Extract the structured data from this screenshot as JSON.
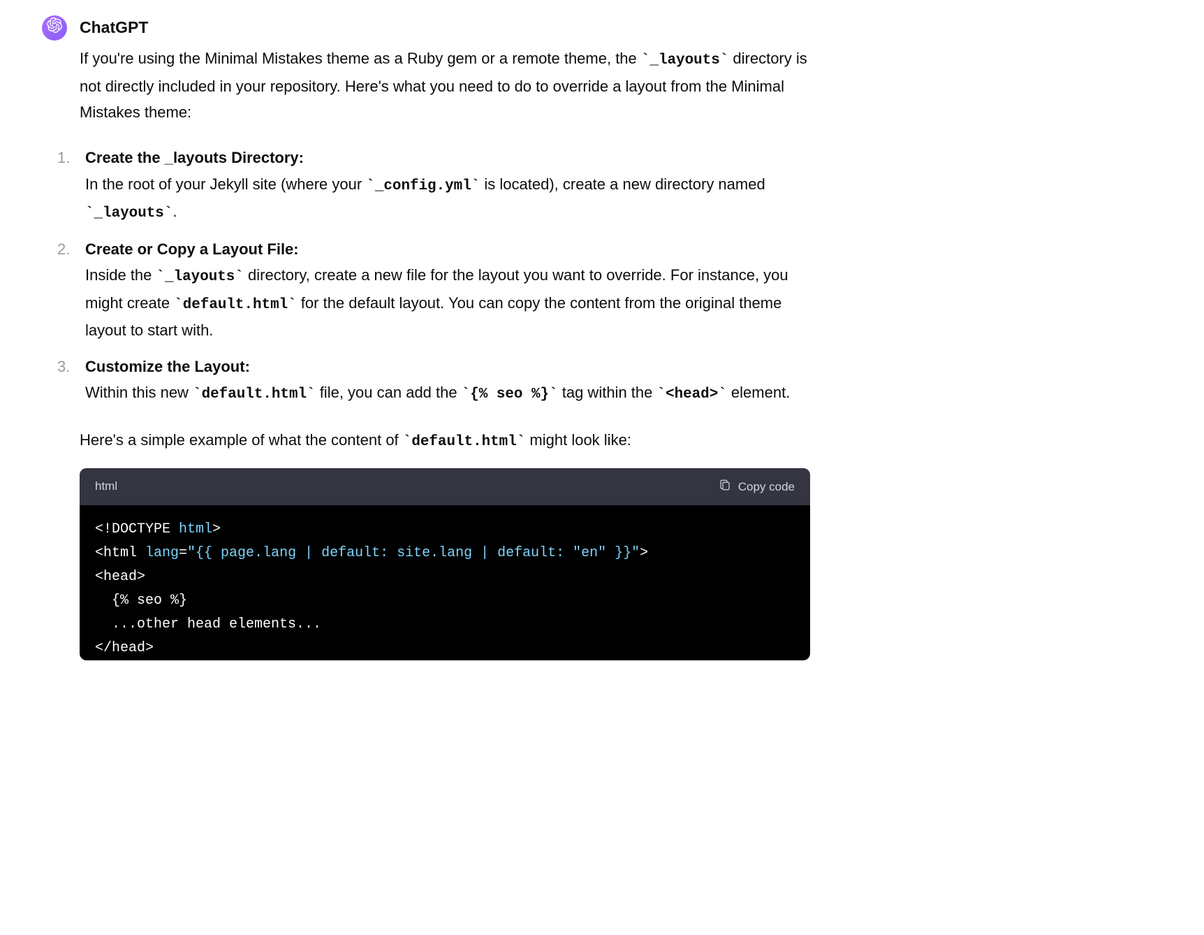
{
  "author": "ChatGPT",
  "intro": {
    "text_before_code1": "If you're using the Minimal Mistakes theme as a Ruby gem or a remote theme, the ",
    "code1": "`_layouts`",
    "text_after_code1": " directory is not directly included in your repository. Here's what you need to do to override a layout from the Minimal Mistakes theme:"
  },
  "steps": [
    {
      "title": "Create the _layouts Directory:",
      "body_parts": [
        {
          "t": "text",
          "v": "In the root of your Jekyll site (where your "
        },
        {
          "t": "code",
          "v": "`_config.yml`"
        },
        {
          "t": "text",
          "v": " is located), create a new directory named "
        },
        {
          "t": "code",
          "v": "`_layouts`"
        },
        {
          "t": "text",
          "v": "."
        }
      ]
    },
    {
      "title": "Create or Copy a Layout File:",
      "body_parts": [
        {
          "t": "text",
          "v": "Inside the "
        },
        {
          "t": "code",
          "v": "`_layouts`"
        },
        {
          "t": "text",
          "v": " directory, create a new file for the layout you want to override. For instance, you might create "
        },
        {
          "t": "code",
          "v": "`default.html`"
        },
        {
          "t": "text",
          "v": " for the default layout. You can copy the content from the original theme layout to start with."
        }
      ]
    },
    {
      "title": "Customize the Layout:",
      "body_parts": [
        {
          "t": "text",
          "v": "Within this new "
        },
        {
          "t": "code",
          "v": "`default.html`"
        },
        {
          "t": "text",
          "v": " file, you can add the "
        },
        {
          "t": "code",
          "v": "`{% seo %}`"
        },
        {
          "t": "text",
          "v": " tag within the "
        },
        {
          "t": "code",
          "v": "`<head>`"
        },
        {
          "t": "text",
          "v": " element."
        }
      ]
    }
  ],
  "outro": {
    "parts": [
      {
        "t": "text",
        "v": "Here's a simple example of what the content of "
      },
      {
        "t": "code",
        "v": "`default.html`"
      },
      {
        "t": "text",
        "v": " might look like:"
      }
    ]
  },
  "codeblock": {
    "language": "html",
    "copy_label": "Copy code",
    "lines": [
      [
        {
          "cls": "tok-plain",
          "v": "<!"
        },
        {
          "cls": "tok-doctype",
          "v": "DOCTYPE "
        },
        {
          "cls": "tok-doctype-name",
          "v": "html"
        },
        {
          "cls": "tok-plain",
          "v": ">"
        }
      ],
      [
        {
          "cls": "tok-plain",
          "v": "<html "
        },
        {
          "cls": "tok-attr",
          "v": "lang"
        },
        {
          "cls": "tok-plain",
          "v": "="
        },
        {
          "cls": "tok-value",
          "v": "\"{{ page.lang | default: site.lang | default: \"en\" }}\""
        },
        {
          "cls": "tok-plain",
          "v": ">"
        }
      ],
      [
        {
          "cls": "tok-plain",
          "v": "<head>"
        }
      ],
      [
        {
          "cls": "tok-plain",
          "v": "  {% seo %}"
        }
      ],
      [
        {
          "cls": "tok-plain",
          "v": "  ...other head elements..."
        }
      ],
      [
        {
          "cls": "tok-plain",
          "v": "</head>"
        }
      ]
    ]
  }
}
